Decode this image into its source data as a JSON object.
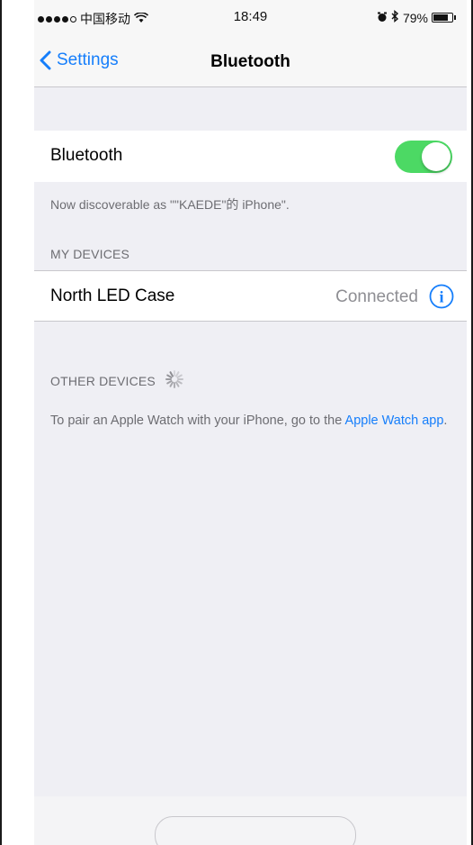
{
  "status_bar": {
    "carrier": "中国移动",
    "time": "18:49",
    "battery_percent": "79%",
    "battery_level": 0.79,
    "icons": [
      "signal-dots",
      "wifi-icon",
      "alarm-icon",
      "bluetooth-icon",
      "battery-icon"
    ]
  },
  "nav": {
    "back_label": "Settings",
    "title": "Bluetooth"
  },
  "bluetooth_row": {
    "label": "Bluetooth",
    "enabled": true
  },
  "discoverable_text": "Now discoverable as \"\"KAEDE\"的 iPhone\".",
  "my_devices": {
    "header": "MY DEVICES",
    "devices": [
      {
        "name": "North LED Case",
        "status": "Connected"
      }
    ]
  },
  "other_devices": {
    "header": "OTHER DEVICES",
    "pair_text": "To pair an Apple Watch with your iPhone, go to the",
    "pair_link": "Apple Watch app",
    "pair_suffix": "."
  },
  "colors": {
    "accent": "#157efb",
    "toggle_on": "#4cd964",
    "background": "#efeff4"
  }
}
